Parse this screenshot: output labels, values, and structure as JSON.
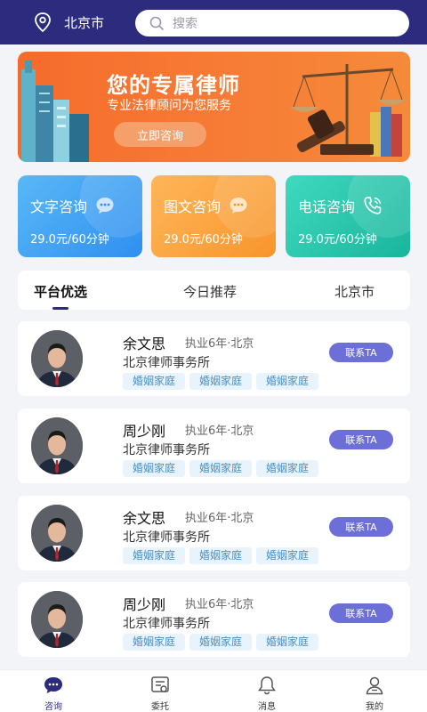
{
  "header": {
    "location": "北京市",
    "search_placeholder": "搜索"
  },
  "banner": {
    "title": "您的专属律师",
    "subtitle": "专业法律顾问为您服务",
    "button": "立即咨询"
  },
  "services": [
    {
      "title": "文字咨询",
      "price": "29.0元/60分钟",
      "icon": "chat-dots-icon"
    },
    {
      "title": "图文咨询",
      "price": "29.0元/60分钟",
      "icon": "chat-dots-icon"
    },
    {
      "title": "电话咨询",
      "price": "29.0元/60分钟",
      "icon": "phone-icon"
    }
  ],
  "tabs": [
    "平台优选",
    "今日推荐",
    "北京市"
  ],
  "lawyers": [
    {
      "name": "余文思",
      "meta": "执业6年·北京",
      "firm": "北京律师事务所",
      "tags": [
        "婚姻家庭",
        "婚姻家庭",
        "婚姻家庭"
      ],
      "contact": "联系TA"
    },
    {
      "name": "周少刚",
      "meta": "执业6年·北京",
      "firm": "北京律师事务所",
      "tags": [
        "婚姻家庭",
        "婚姻家庭",
        "婚姻家庭"
      ],
      "contact": "联系TA"
    },
    {
      "name": "余文思",
      "meta": "执业6年·北京",
      "firm": "北京律师事务所",
      "tags": [
        "婚姻家庭",
        "婚姻家庭",
        "婚姻家庭"
      ],
      "contact": "联系TA"
    },
    {
      "name": "周少刚",
      "meta": "执业6年·北京",
      "firm": "北京律师事务所",
      "tags": [
        "婚姻家庭",
        "婚姻家庭",
        "婚姻家庭"
      ],
      "contact": "联系TA"
    }
  ],
  "bottom_nav": [
    {
      "label": "咨询",
      "icon": "chat-icon",
      "active": true
    },
    {
      "label": "委托",
      "icon": "entrust-icon",
      "active": false
    },
    {
      "label": "消息",
      "icon": "bell-icon",
      "active": false
    },
    {
      "label": "我的",
      "icon": "user-icon",
      "active": false
    }
  ],
  "colors": {
    "primary": "#2c2b7e",
    "banner": "#f56b2b",
    "card_blue": "#2f8ff0",
    "card_orange": "#f8952b",
    "card_teal": "#19b59c",
    "contact_button": "#6c6fd8"
  }
}
